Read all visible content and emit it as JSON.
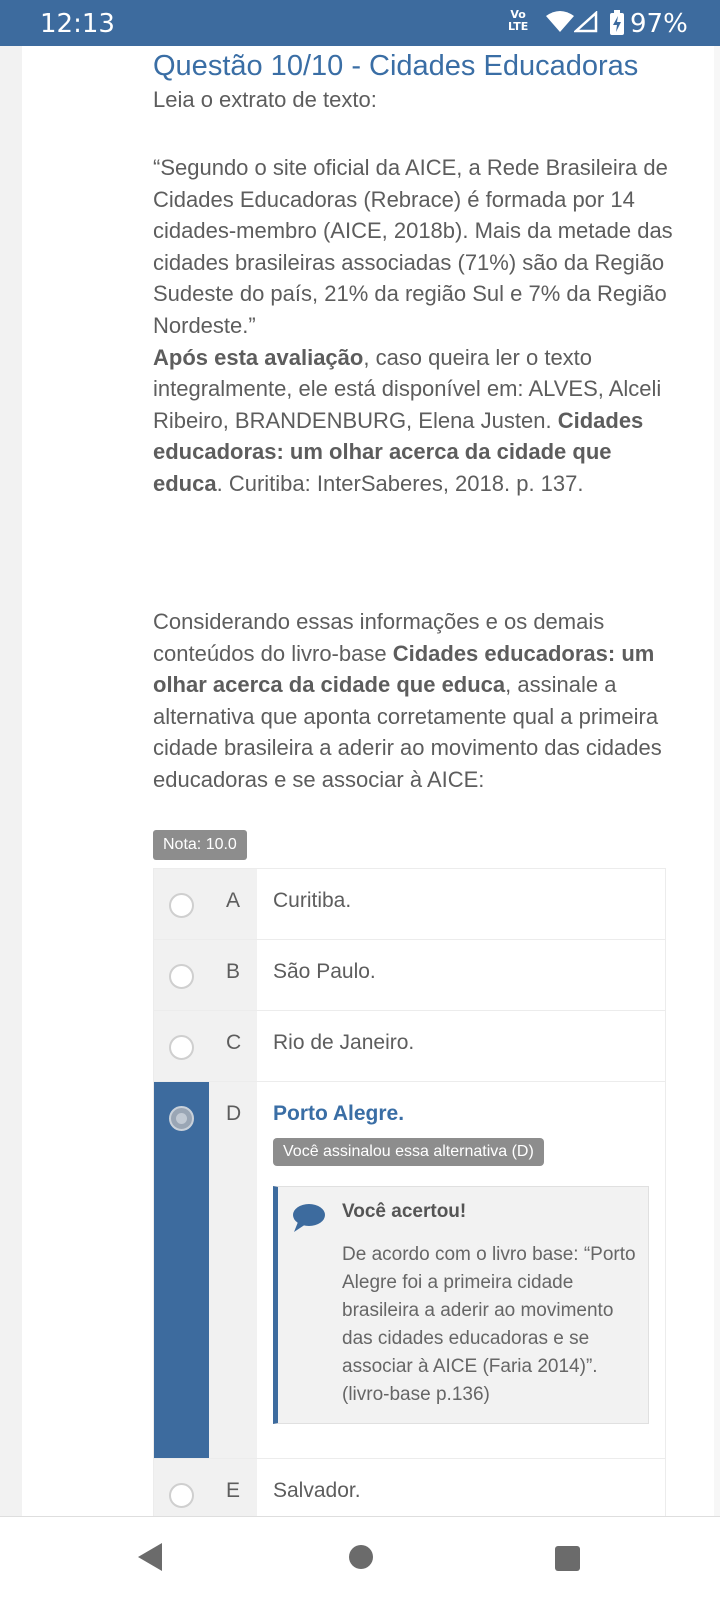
{
  "status_bar": {
    "time": "12:13",
    "volte_top": "Vo",
    "volte_bottom": "LTE",
    "battery": "97%"
  },
  "question": {
    "title": "Questão 10/10 - Cidades Educadoras",
    "intro": "Leia o extrato de texto:",
    "quote": "“Segundo o site oficial da AICE, a Rede Brasileira de Cidades Educadoras (Rebrace) é formada por 14 cidades-membro (AICE, 2018b). Mais da metade das cidades brasileiras associadas (71%) são da Região Sudeste do país, 21% da região Sul e 7% da Região Nordeste.”",
    "source_bold1": "Após esta avaliação",
    "source_text1": ", caso queira ler o texto integralmente, ele está disponível em: ALVES, Alceli Ribeiro, BRANDENBURG, Elena Justen. ",
    "source_bold2": "Cidades educadoras: um olhar acerca da cidade que educa",
    "source_text2": ". Curitiba: InterSaberes, 2018. p. 137.",
    "prompt_text1": "Considerando essas informações e os demais conteúdos do livro-base ",
    "prompt_bold": "Cidades educadoras: um olhar acerca da cidade que educa",
    "prompt_text2": ", assinale a alternativa que aponta corretamente qual a primeira cidade brasileira a aderir ao movimento das cidades educadoras e se associar à AICE:",
    "grade": "Nota: 10.0"
  },
  "options": [
    {
      "letter": "A",
      "text": "Curitiba."
    },
    {
      "letter": "B",
      "text": "São Paulo."
    },
    {
      "letter": "C",
      "text": "Rio de Janeiro."
    },
    {
      "letter": "D",
      "text": "Porto Alegre."
    },
    {
      "letter": "E",
      "text": "Salvador."
    }
  ],
  "selected": {
    "badge": "Você assinalou essa alternativa (D)",
    "feedback_title": "Você acertou!",
    "feedback_text": "De acordo com o livro base: “Porto Alegre foi a primeira cidade brasileira a aderir ao movimento das cidades educadoras e se associar à AICE (Faria 2014)”. (livro-base p.136)"
  },
  "colors": {
    "accent": "#3d6b9e",
    "title": "#3a6ea5",
    "badge": "#8d8d8d"
  },
  "icons": [
    "wifi-icon",
    "signal-icon",
    "battery-icon",
    "speech-bubble-icon",
    "back-icon",
    "home-icon",
    "recents-icon"
  ]
}
